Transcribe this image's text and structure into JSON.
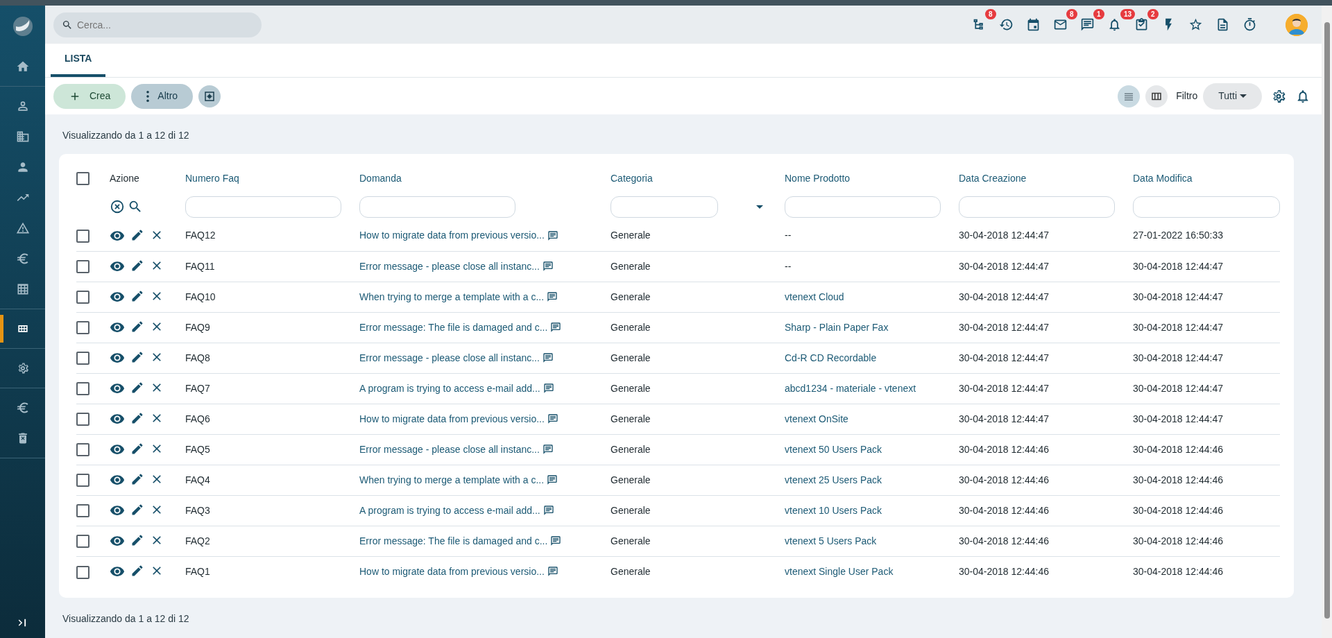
{
  "sidebar": {
    "groups": [
      {
        "items": [
          {
            "kind": "home",
            "selected": false
          }
        ]
      },
      {
        "items": [
          {
            "kind": "contact",
            "selected": false
          },
          {
            "kind": "building",
            "selected": false
          },
          {
            "kind": "person",
            "selected": false
          },
          {
            "kind": "trend",
            "selected": false
          },
          {
            "kind": "warning",
            "selected": false
          },
          {
            "kind": "euro",
            "selected": false
          },
          {
            "kind": "table",
            "selected": false
          }
        ]
      },
      {
        "items": [
          {
            "kind": "apps",
            "selected": true
          }
        ]
      },
      {
        "items": [
          {
            "kind": "gear",
            "selected": false
          }
        ]
      },
      {
        "items": [
          {
            "kind": "euro",
            "selected": false
          },
          {
            "kind": "trash",
            "selected": false
          }
        ]
      }
    ]
  },
  "topbar": {
    "search": {
      "placeholder": "Cerca..."
    },
    "icons": [
      {
        "kind": "hierarchy",
        "badge": "8"
      },
      {
        "kind": "history"
      },
      {
        "kind": "calendar"
      },
      {
        "kind": "mail",
        "badge": "8"
      },
      {
        "kind": "chat",
        "badge": "1"
      },
      {
        "kind": "bell",
        "badge": "13"
      },
      {
        "kind": "task",
        "badge": "2"
      },
      {
        "kind": "bolt"
      },
      {
        "kind": "star"
      },
      {
        "kind": "document"
      },
      {
        "kind": "timer"
      }
    ]
  },
  "tabs": [
    {
      "label": "LISTA",
      "selected": true
    }
  ],
  "toolbar": {
    "buttons": [
      {
        "kind": "create",
        "label": "Crea"
      },
      {
        "kind": "more",
        "label": "Altro"
      },
      {
        "kind": "settings"
      }
    ],
    "views": [
      {
        "kind": "list",
        "selected": true
      },
      {
        "kind": "columns",
        "selected": false
      }
    ],
    "filter": {
      "label": "Filtro",
      "value": "Tutti"
    }
  },
  "summary_top": "Visualizzando da 1 a 12 di 12",
  "table": {
    "checked": false,
    "columns": [
      "Azione",
      "Numero Faq",
      "Domanda",
      "Categoria",
      "Nome Prodotto",
      "Data Creazione",
      "Data Modifica"
    ],
    "rows": [
      {
        "checked": false,
        "number": "FAQ12",
        "question": "How to migrate data from previous versio...",
        "category": "Generale",
        "product": {
          "text": "--",
          "link": false
        },
        "created": "30-04-2018 12:44:47",
        "modified": "27-01-2022 16:50:33"
      },
      {
        "checked": false,
        "number": "FAQ11",
        "question": "Error message - please close all instanc...",
        "category": "Generale",
        "product": {
          "text": "--",
          "link": false
        },
        "created": "30-04-2018 12:44:47",
        "modified": "30-04-2018 12:44:47"
      },
      {
        "checked": false,
        "number": "FAQ10",
        "question": "When trying to merge a template with a c...",
        "category": "Generale",
        "product": {
          "text": "vtenext Cloud",
          "link": true
        },
        "created": "30-04-2018 12:44:47",
        "modified": "30-04-2018 12:44:47"
      },
      {
        "checked": false,
        "number": "FAQ9",
        "question": "Error message: The file is damaged and c...",
        "category": "Generale",
        "product": {
          "text": "Sharp - Plain Paper Fax",
          "link": true
        },
        "created": "30-04-2018 12:44:47",
        "modified": "30-04-2018 12:44:47"
      },
      {
        "checked": false,
        "number": "FAQ8",
        "question": "Error message - please close all instanc...",
        "category": "Generale",
        "product": {
          "text": "Cd-R CD Recordable",
          "link": true
        },
        "created": "30-04-2018 12:44:47",
        "modified": "30-04-2018 12:44:47"
      },
      {
        "checked": false,
        "number": "FAQ7",
        "question": "A program is trying to access e-mail add...",
        "category": "Generale",
        "product": {
          "text": "abcd1234 - materiale - vtenext",
          "link": true
        },
        "created": "30-04-2018 12:44:47",
        "modified": "30-04-2018 12:44:47"
      },
      {
        "checked": false,
        "number": "FAQ6",
        "question": "How to migrate data from previous versio...",
        "category": "Generale",
        "product": {
          "text": "vtenext OnSite",
          "link": true
        },
        "created": "30-04-2018 12:44:47",
        "modified": "30-04-2018 12:44:47"
      },
      {
        "checked": false,
        "number": "FAQ5",
        "question": "Error message - please close all instanc...",
        "category": "Generale",
        "product": {
          "text": "vtenext 50 Users Pack",
          "link": true
        },
        "created": "30-04-2018 12:44:46",
        "modified": "30-04-2018 12:44:46"
      },
      {
        "checked": false,
        "number": "FAQ4",
        "question": "When trying to merge a template with a c...",
        "category": "Generale",
        "product": {
          "text": "vtenext 25 Users Pack",
          "link": true
        },
        "created": "30-04-2018 12:44:46",
        "modified": "30-04-2018 12:44:46"
      },
      {
        "checked": false,
        "number": "FAQ3",
        "question": "A program is trying to access e-mail add...",
        "category": "Generale",
        "product": {
          "text": "vtenext 10 Users Pack",
          "link": true
        },
        "created": "30-04-2018 12:44:46",
        "modified": "30-04-2018 12:44:46"
      },
      {
        "checked": false,
        "number": "FAQ2",
        "question": "Error message: The file is damaged and c...",
        "category": "Generale",
        "product": {
          "text": "vtenext 5 Users Pack",
          "link": true
        },
        "created": "30-04-2018 12:44:46",
        "modified": "30-04-2018 12:44:46"
      },
      {
        "checked": false,
        "number": "FAQ1",
        "question": "How to migrate data from previous versio...",
        "category": "Generale",
        "product": {
          "text": "vtenext Single User Pack",
          "link": true
        },
        "created": "30-04-2018 12:44:46",
        "modified": "30-04-2018 12:44:46"
      }
    ]
  },
  "summary_bottom": "Visualizzando da 1 a 12 di 12"
}
